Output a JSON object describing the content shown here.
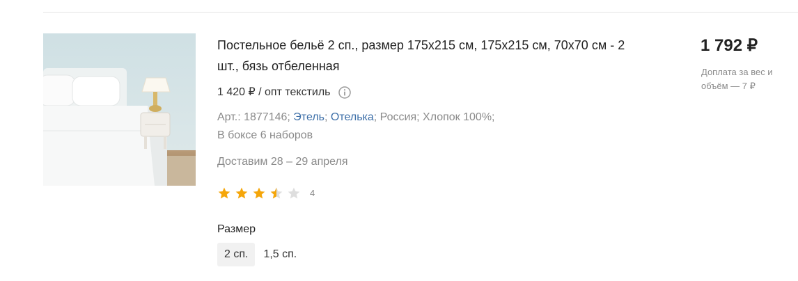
{
  "product": {
    "title": "Постельное бельё 2 сп., размер 175х215 см, 175х215 см, 70х70 см - 2 шт., бязь отбеленная",
    "supplier_price": "1 420 ₽ / опт текстиль",
    "meta": {
      "article": "Арт.: 1877146;",
      "brand_link": "Этель",
      "sep1": ";",
      "collection_link": "Отелька",
      "rest_line1": "; Россия; Хлопок 100%;",
      "line2": "В боксе 6 наборов"
    },
    "delivery": "Доставим 28 – 29 апреля",
    "rating": {
      "value": 3.5,
      "max": 5,
      "count": "4"
    },
    "size": {
      "label": "Размер",
      "options": [
        "2 сп.",
        "1,5 сп."
      ],
      "selected": "2 сп."
    },
    "price": "1 792 ₽",
    "surcharge": "Доплата за вес и объём — 7 ₽"
  },
  "colors": {
    "link": "#3d6fa8",
    "star_filled": "#f5a60a",
    "star_empty": "#dedede",
    "muted_text": "#8a8a8a"
  },
  "icons": {
    "info": "info-circle-icon",
    "star": "star-icon"
  }
}
